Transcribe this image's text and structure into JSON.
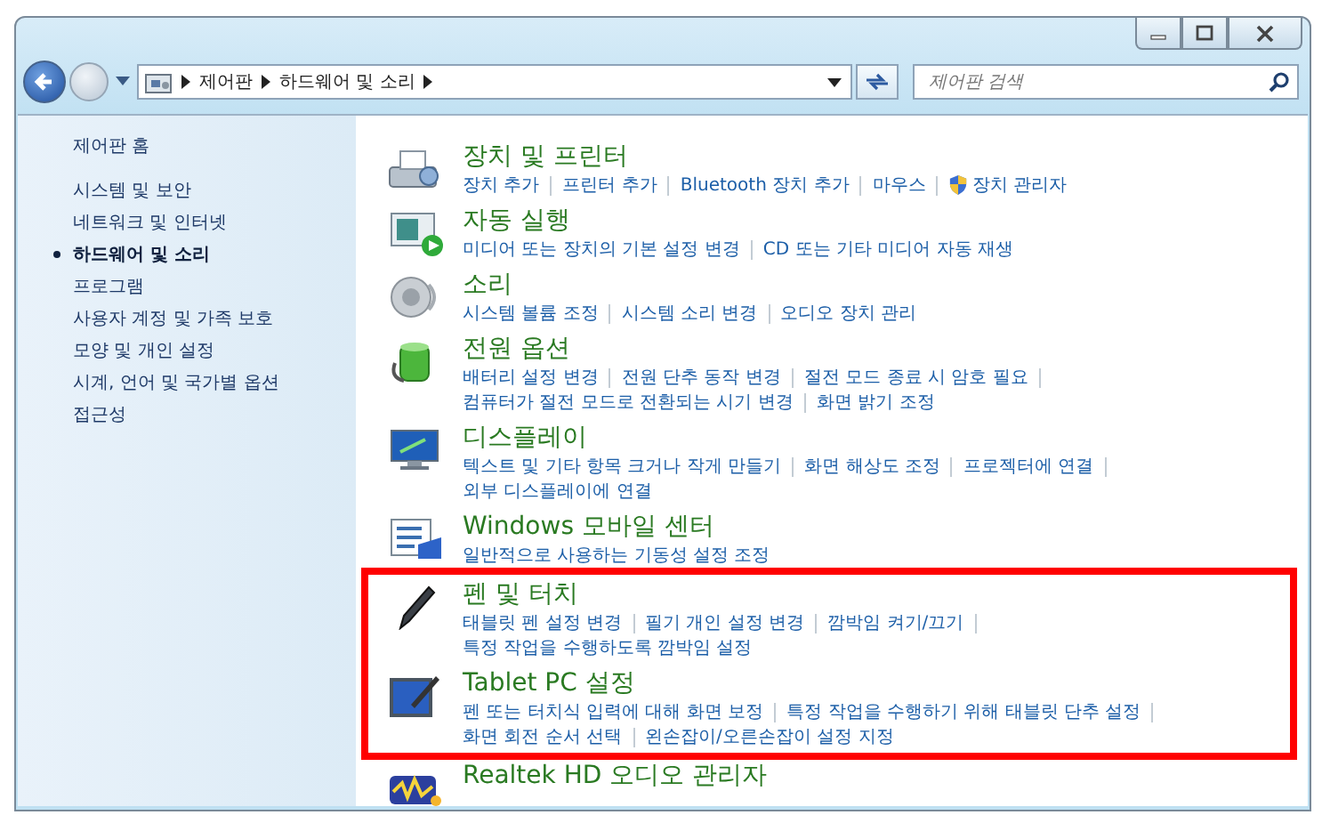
{
  "navigation": {
    "breadcrumb": [
      "제어판",
      "하드웨어 및 소리"
    ],
    "search": {
      "placeholder": "제어판 검색"
    }
  },
  "sidebar": {
    "home": "제어판 홈",
    "items": [
      {
        "label": "시스템 및 보안",
        "selected": false
      },
      {
        "label": "네트워크 및 인터넷",
        "selected": false
      },
      {
        "label": "하드웨어 및 소리",
        "selected": true
      },
      {
        "label": "프로그램",
        "selected": false
      },
      {
        "label": "사용자 계정 및 가족 보호",
        "selected": false
      },
      {
        "label": "모양 및 개인 설정",
        "selected": false
      },
      {
        "label": "시계, 언어 및 국가별 옵션",
        "selected": false
      },
      {
        "label": "접근성",
        "selected": false
      }
    ]
  },
  "sections": [
    {
      "title": "장치 및 프린터",
      "highlighted": false,
      "lines": [
        [
          {
            "label": "장치 추가"
          },
          {
            "label": "프린터 추가"
          },
          {
            "label": "Bluetooth 장치 추가"
          },
          {
            "label": "마우스"
          },
          {
            "label": "장치 관리자",
            "shield": true
          }
        ]
      ]
    },
    {
      "title": "자동 실행",
      "highlighted": false,
      "lines": [
        [
          {
            "label": "미디어 또는 장치의 기본 설정 변경"
          },
          {
            "label": "CD 또는 기타 미디어 자동 재생"
          }
        ]
      ]
    },
    {
      "title": "소리",
      "highlighted": false,
      "lines": [
        [
          {
            "label": "시스템 볼륨 조정"
          },
          {
            "label": "시스템 소리 변경"
          },
          {
            "label": "오디오 장치 관리"
          }
        ]
      ]
    },
    {
      "title": "전원 옵션",
      "highlighted": false,
      "lines": [
        [
          {
            "label": "배터리 설정 변경"
          },
          {
            "label": "전원 단추 동작 변경"
          },
          {
            "label": "절전 모드 종료 시 암호 필요"
          }
        ],
        [
          {
            "label": "컴퓨터가 절전 모드로 전환되는 시기 변경"
          },
          {
            "label": "화면 밝기 조정"
          }
        ]
      ]
    },
    {
      "title": "디스플레이",
      "highlighted": false,
      "lines": [
        [
          {
            "label": "텍스트 및 기타 항목 크거나 작게 만들기"
          },
          {
            "label": "화면 해상도 조정"
          },
          {
            "label": "프로젝터에 연결"
          }
        ],
        [
          {
            "label": "외부 디스플레이에 연결"
          }
        ]
      ]
    },
    {
      "title": "Windows 모바일 센터",
      "highlighted": false,
      "lines": [
        [
          {
            "label": "일반적으로 사용하는 기동성 설정 조정"
          }
        ]
      ]
    },
    {
      "title": "펜 및 터치",
      "highlighted": true,
      "lines": [
        [
          {
            "label": "태블릿 펜 설정 변경"
          },
          {
            "label": "필기 개인 설정 변경"
          },
          {
            "label": "깜박임 켜기/끄기"
          }
        ],
        [
          {
            "label": "특정 작업을 수행하도록 깜박임 설정"
          }
        ]
      ]
    },
    {
      "title": "Tablet PC 설정",
      "highlighted": true,
      "lines": [
        [
          {
            "label": "펜 또는 터치식 입력에 대해 화면 보정"
          },
          {
            "label": "특정 작업을 수행하기 위해 태블릿 단추 설정"
          }
        ],
        [
          {
            "label": "화면 회전 순서 선택"
          },
          {
            "label": "왼손잡이/오른손잡이 설정 지정"
          }
        ]
      ]
    },
    {
      "title": "Realtek HD 오디오 관리자",
      "highlighted": false
    }
  ]
}
